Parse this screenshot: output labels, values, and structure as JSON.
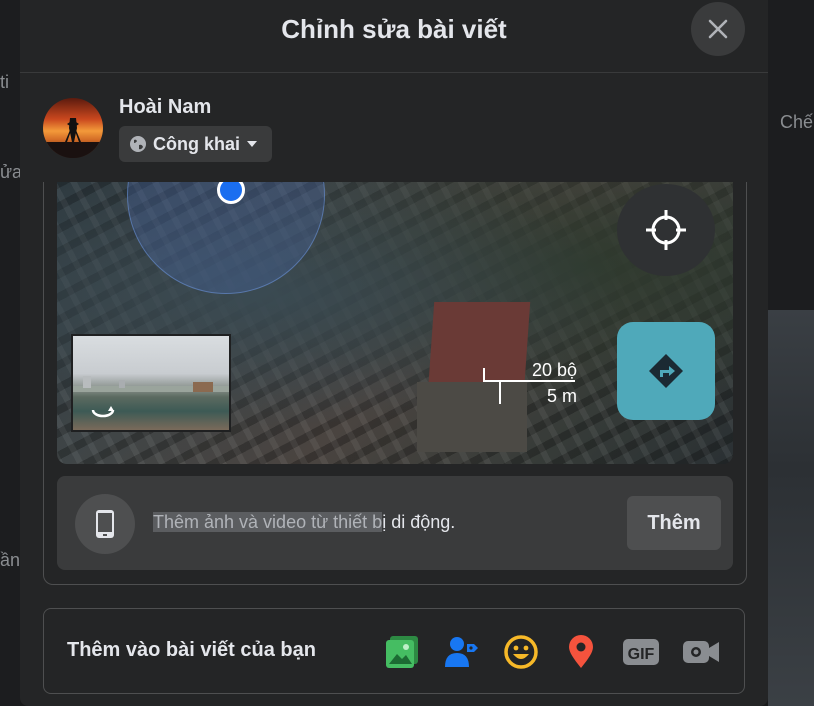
{
  "background": {
    "left_fragments": [
      "ti",
      "ửa",
      "ần"
    ],
    "right_fragment": "Chế"
  },
  "modal": {
    "title": "Chỉnh sửa bài viết",
    "close_label": "×"
  },
  "user": {
    "name": "Hoài Nam",
    "privacy": "Công khai"
  },
  "map": {
    "scale_top": "20 bộ",
    "scale_bottom": "5 m"
  },
  "mobile_upload": {
    "text_highlighted": "Thêm ảnh và video từ thiết b",
    "text_rest": "ị di động.",
    "button": "Thêm"
  },
  "add_to_post": {
    "label": "Thêm vào bài viết của bạn",
    "tools": [
      "photo-video-icon",
      "tag-people-icon",
      "feeling-icon",
      "check-in-icon",
      "gif-icon",
      "live-video-icon"
    ],
    "gif_text": "GIF"
  },
  "colors": {
    "modal_bg": "#242526",
    "accent_blue": "#1a6ef0",
    "directions_bg": "#4fa9ba",
    "photo_green": "#45bd62",
    "tag_blue": "#1877f2",
    "feeling_yellow": "#f7b928",
    "checkin_red": "#f5533d"
  }
}
